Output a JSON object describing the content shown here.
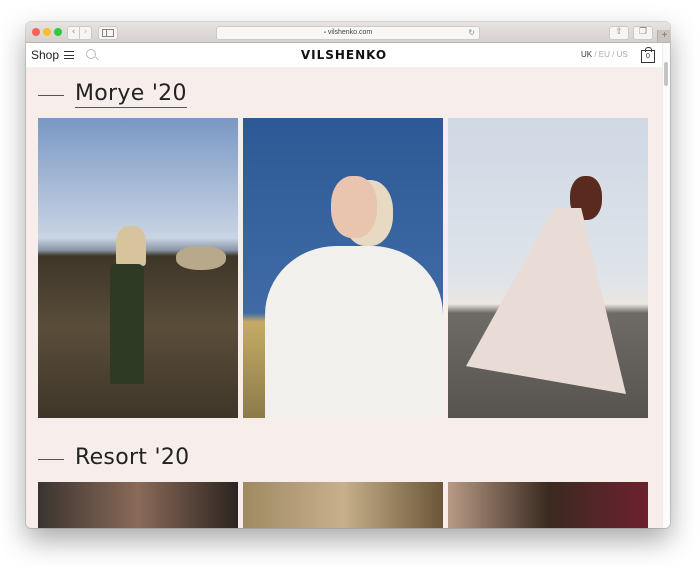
{
  "browser": {
    "url": "vilshenko.com",
    "nav_back_glyph": "‹",
    "nav_forward_glyph": "›",
    "reload_glyph": "↻",
    "lock_glyph": "🔒",
    "share_glyph": "⇧",
    "tabs_glyph": "❐",
    "new_tab_glyph": "+"
  },
  "header": {
    "shop_label": "Shop",
    "logo": "VILSHENKO",
    "regions": [
      "UK",
      "EU",
      "US"
    ],
    "active_region": "UK",
    "separator": " / ",
    "cart_count": "0"
  },
  "sections": [
    {
      "title": "Morye '20",
      "underlined": true,
      "photos": [
        {
          "alt": "Model on rocky shore in floral skirt and cream top",
          "sky": "#7a98c4",
          "ground": "#3e3628",
          "accent": "#d8c49c"
        },
        {
          "alt": "Model in white eyelet dress and headscarf against blue sky",
          "sky": "#2d5a96",
          "ground": "#8b7a4a",
          "accent": "#f2f0ec"
        },
        {
          "alt": "Model twirling floral maxi dress on seaside rocks",
          "sky": "#dfe4ea",
          "ground": "#6e6b66",
          "accent": "#e9dcd6"
        }
      ]
    },
    {
      "title": "Resort '20",
      "underlined": false,
      "photos": [
        {
          "alt": "Close-up of model in dim interior",
          "sky": "#3a3430",
          "ground": "#2c2420",
          "accent": "#8a6a58"
        },
        {
          "alt": "Model seated in room with patterned wallpaper",
          "sky": "#a08a62",
          "ground": "#6a5638",
          "accent": "#c7b08a"
        },
        {
          "alt": "Interior with red curtain, damask wallpaper and framed picture",
          "sky": "#b89a86",
          "ground": "#6e2030",
          "accent": "#3a2a20"
        }
      ]
    }
  ],
  "colors": {
    "page_bg": "#f7eeeb",
    "text": "#222222",
    "muted": "#aaaaaa"
  }
}
